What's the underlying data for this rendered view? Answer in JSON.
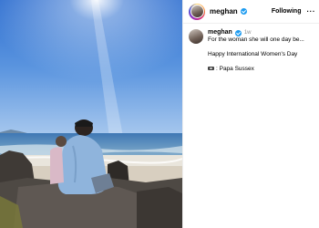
{
  "post": {
    "username": "meghan",
    "follow_status": "Following",
    "more_glyph": "···",
    "time_ago": "1w",
    "caption_line1": "For the woman she will one day be...",
    "caption_line2": "Happy International Women's Day",
    "caption_line3": ": Papa Sussex"
  },
  "colors": {
    "verified_badge": "#1d9bf0",
    "timestamp": "#8e8e8e",
    "ring_gradient": [
      "#feda75",
      "#fa7e1e",
      "#d62976",
      "#962fbf",
      "#4f5bd5"
    ]
  },
  "icons": {
    "verified": "verified-badge-icon",
    "more": "more-options-icon",
    "camera": "movie-camera-icon"
  }
}
